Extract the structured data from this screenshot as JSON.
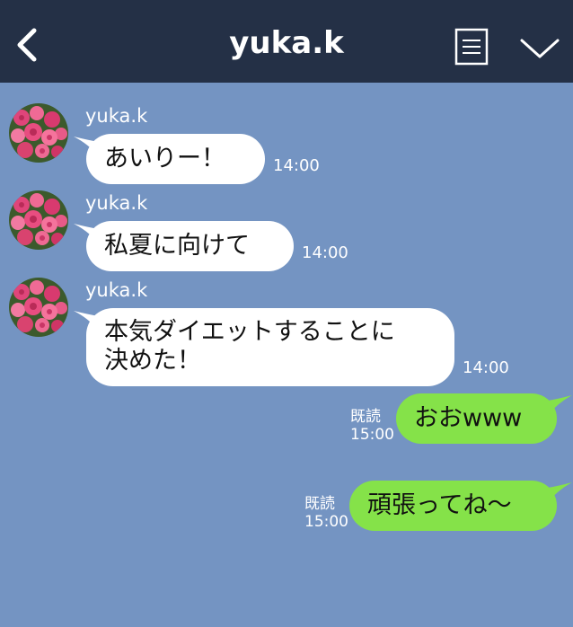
{
  "header": {
    "title": "yuka.k",
    "back_icon": "chevron-left-icon",
    "menu_icon": "note-menu-icon",
    "dropdown_icon": "chevron-down-icon"
  },
  "colors": {
    "header_bg": "#243046",
    "chat_bg": "#7494c2",
    "incoming_bubble": "#ffffff",
    "outgoing_bubble": "#85e249"
  },
  "messages": [
    {
      "direction": "in",
      "sender": "yuka.k",
      "text": "あいりー！",
      "time": "14:00"
    },
    {
      "direction": "in",
      "sender": "yuka.k",
      "text": "私夏に向けて",
      "time": "14:00"
    },
    {
      "direction": "in",
      "sender": "yuka.k",
      "line1": "本気ダイエットすることに",
      "line2": "決めた！",
      "time": "14:00"
    },
    {
      "direction": "out",
      "text": "おおwww",
      "read": "既読",
      "time": "15:00"
    },
    {
      "direction": "out",
      "text": "頑張ってね〜",
      "read": "既読",
      "time": "15:00"
    }
  ]
}
